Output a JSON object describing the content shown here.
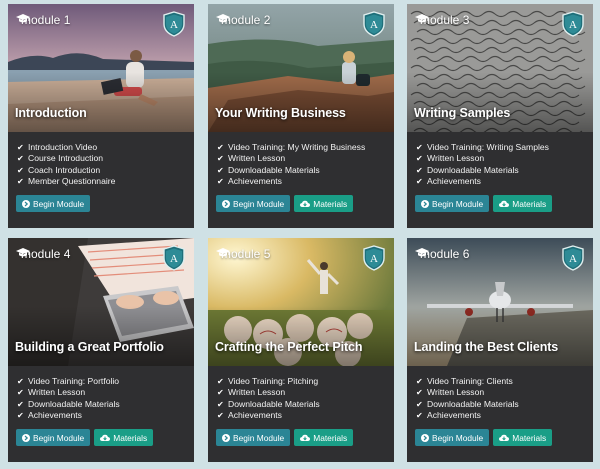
{
  "modules": [
    {
      "label": "module 1",
      "title": "Introduction",
      "items": [
        "Introduction Video",
        "Course Introduction",
        "Coach Introduction",
        "Member Questionnaire"
      ],
      "begin_label": "Begin Module",
      "materials_label": null,
      "scene": "beach-laptop"
    },
    {
      "label": "module 2",
      "title": "Your Writing Business",
      "items": [
        "Video Training: My Writing Business",
        "Written Lesson",
        "Downloadable Materials",
        "Achievements"
      ],
      "begin_label": "Begin Module",
      "materials_label": "Materials",
      "scene": "cliff-sitting"
    },
    {
      "label": "module 3",
      "title": "Writing Samples",
      "items": [
        "Video Training: Writing Samples",
        "Written Lesson",
        "Downloadable Materials",
        "Achievements"
      ],
      "begin_label": "Begin Module",
      "materials_label": "Materials",
      "scene": "handwriting"
    },
    {
      "label": "module 4",
      "title": "Building a Great Portfolio",
      "items": [
        "Video Training: Portfolio",
        "Written Lesson",
        "Downloadable Materials",
        "Achievements"
      ],
      "begin_label": "Begin Module",
      "materials_label": "Materials",
      "scene": "typing-laptop"
    },
    {
      "label": "module 5",
      "title": "Crafting the Perfect Pitch",
      "items": [
        "Video Training: Pitching",
        "Written Lesson",
        "Downloadable Materials",
        "Achievements"
      ],
      "begin_label": "Begin Module",
      "materials_label": "Materials",
      "scene": "baseball-pitch"
    },
    {
      "label": "module 6",
      "title": "Landing the Best Clients",
      "items": [
        "Video Training: Clients",
        "Written Lesson",
        "Downloadable Materials",
        "Achievements"
      ],
      "begin_label": "Begin Module",
      "materials_label": "Materials",
      "scene": "airplane-landing"
    }
  ],
  "colors": {
    "page_bg": "#cfe1e5",
    "card_bg": "#2f2f31",
    "begin_button": "#2b8595",
    "materials_button": "#1a9e87"
  },
  "icons": {
    "module": "graduation-cap-icon",
    "badge": "shield-a-icon",
    "list": "check-icon",
    "begin": "arrow-circle-right-icon",
    "materials": "cloud-download-icon"
  }
}
